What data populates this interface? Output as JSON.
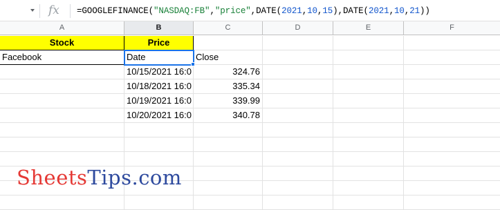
{
  "formula_bar": {
    "fx_label": "fx",
    "formula_parts": [
      {
        "text": "=GOOGLEFINANCE(",
        "kind": "plain"
      },
      {
        "text": "\"NASDAQ:FB\"",
        "kind": "str"
      },
      {
        "text": ",",
        "kind": "plain"
      },
      {
        "text": "\"price\"",
        "kind": "str"
      },
      {
        "text": ",DATE(",
        "kind": "plain"
      },
      {
        "text": "2021",
        "kind": "num"
      },
      {
        "text": ",",
        "kind": "plain"
      },
      {
        "text": "10",
        "kind": "num"
      },
      {
        "text": ",",
        "kind": "plain"
      },
      {
        "text": "15",
        "kind": "num"
      },
      {
        "text": "),DATE(",
        "kind": "plain"
      },
      {
        "text": "2021",
        "kind": "num"
      },
      {
        "text": ",",
        "kind": "plain"
      },
      {
        "text": "10",
        "kind": "num"
      },
      {
        "text": ",",
        "kind": "plain"
      },
      {
        "text": "21",
        "kind": "num"
      },
      {
        "text": "))",
        "kind": "plain"
      }
    ]
  },
  "columns": [
    "A",
    "B",
    "C",
    "D",
    "E",
    "F"
  ],
  "active_column": "B",
  "header_row": {
    "a1": "Stock",
    "b1": "Price",
    "fill_color": "#ffff00"
  },
  "row2": {
    "a2": "Facebook",
    "b2": "Date",
    "c2": "Close"
  },
  "data_rows": [
    {
      "date": "10/15/2021 16:0",
      "close": "324.76"
    },
    {
      "date": "10/18/2021 16:0",
      "close": "335.34"
    },
    {
      "date": "10/19/2021 16:0",
      "close": "339.99"
    },
    {
      "date": "10/20/2021 16:0",
      "close": "340.78"
    }
  ],
  "watermark": {
    "part1": "Sheets",
    "part2": "Tips.com",
    "color1": "#e53935",
    "color2": "#2e4a9e"
  },
  "colors": {
    "selection": "#1a73e8",
    "formula_string": "#188038",
    "formula_number": "#1155cc"
  }
}
